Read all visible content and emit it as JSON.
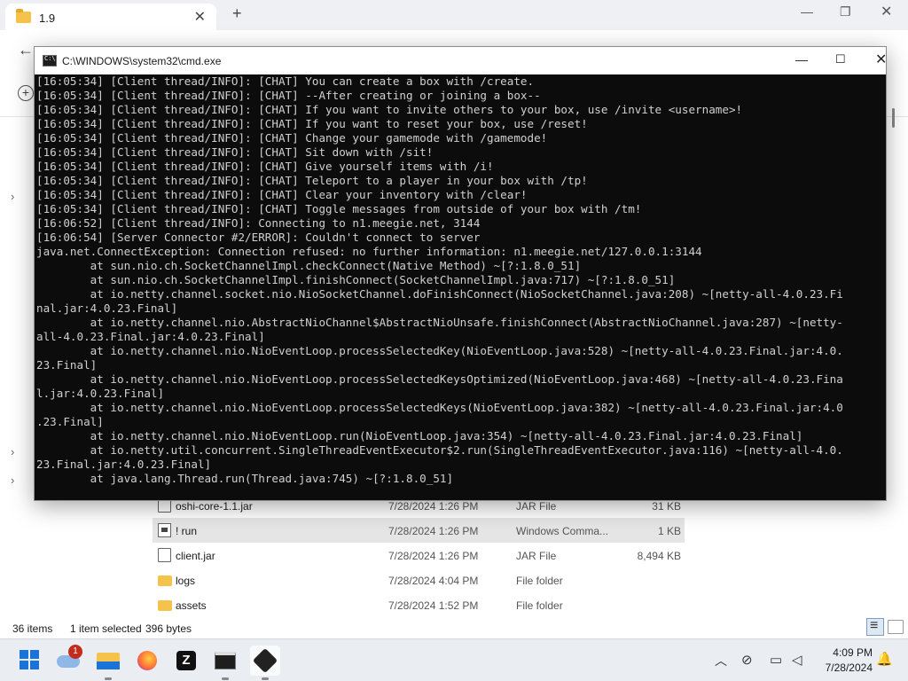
{
  "explorer": {
    "tab_title": "1.9",
    "tab_close": "✕",
    "new_tab": "+",
    "window_min": "—",
    "window_max": "❐",
    "window_close": "✕",
    "back_icon": "←",
    "new_icon": "+",
    "files": [
      {
        "name": "oshi-core-1.1.jar",
        "date": "7/28/2024 1:26 PM",
        "type": "JAR File",
        "size": "31 KB",
        "icon": "document-icon",
        "selected": false
      },
      {
        "name": "! run",
        "date": "7/28/2024 1:26 PM",
        "type": "Windows Comma...",
        "size": "1 KB",
        "icon": "batch-file-icon",
        "selected": true
      },
      {
        "name": "client.jar",
        "date": "7/28/2024 1:26 PM",
        "type": "JAR File",
        "size": "8,494 KB",
        "icon": "document-icon",
        "selected": false
      },
      {
        "name": "logs",
        "date": "7/28/2024 4:04 PM",
        "type": "File folder",
        "size": "",
        "icon": "folder-icon",
        "selected": false
      },
      {
        "name": "assets",
        "date": "7/28/2024 1:52 PM",
        "type": "File folder",
        "size": "",
        "icon": "folder-icon",
        "selected": false
      }
    ],
    "status": {
      "item_count": "36 items",
      "selection": "1 item selected",
      "selection_size": "396 bytes"
    }
  },
  "cmd": {
    "title": "C:\\WINDOWS\\system32\\cmd.exe",
    "min": "—",
    "max": "☐",
    "close": "✕",
    "lines": [
      "[16:05:34] [Client thread/INFO]: [CHAT] You can create a box with /create.",
      "[16:05:34] [Client thread/INFO]: [CHAT] --After creating or joining a box--",
      "[16:05:34] [Client thread/INFO]: [CHAT] If you want to invite others to your box, use /invite <username>!",
      "[16:05:34] [Client thread/INFO]: [CHAT] If you want to reset your box, use /reset!",
      "[16:05:34] [Client thread/INFO]: [CHAT] Change your gamemode with /gamemode!",
      "[16:05:34] [Client thread/INFO]: [CHAT] Sit down with /sit!",
      "[16:05:34] [Client thread/INFO]: [CHAT] Give yourself items with /i!",
      "[16:05:34] [Client thread/INFO]: [CHAT] Teleport to a player in your box with /tp!",
      "[16:05:34] [Client thread/INFO]: [CHAT] Clear your inventory with /clear!",
      "[16:05:34] [Client thread/INFO]: [CHAT] Toggle messages from outside of your box with /tm!",
      "[16:06:52] [Client thread/INFO]: Connecting to n1.meegie.net, 3144",
      "[16:06:54] [Server Connector #2/ERROR]: Couldn't connect to server",
      "java.net.ConnectException: Connection refused: no further information: n1.meegie.net/127.0.0.1:3144",
      "        at sun.nio.ch.SocketChannelImpl.checkConnect(Native Method) ~[?:1.8.0_51]",
      "        at sun.nio.ch.SocketChannelImpl.finishConnect(SocketChannelImpl.java:717) ~[?:1.8.0_51]",
      "        at io.netty.channel.socket.nio.NioSocketChannel.doFinishConnect(NioSocketChannel.java:208) ~[netty-all-4.0.23.Fi",
      "nal.jar:4.0.23.Final]",
      "        at io.netty.channel.nio.AbstractNioChannel$AbstractNioUnsafe.finishConnect(AbstractNioChannel.java:287) ~[netty-",
      "all-4.0.23.Final.jar:4.0.23.Final]",
      "        at io.netty.channel.nio.NioEventLoop.processSelectedKey(NioEventLoop.java:528) ~[netty-all-4.0.23.Final.jar:4.0.",
      "23.Final]",
      "        at io.netty.channel.nio.NioEventLoop.processSelectedKeysOptimized(NioEventLoop.java:468) ~[netty-all-4.0.23.Fina",
      "l.jar:4.0.23.Final]",
      "        at io.netty.channel.nio.NioEventLoop.processSelectedKeys(NioEventLoop.java:382) ~[netty-all-4.0.23.Final.jar:4.0",
      ".23.Final]",
      "        at io.netty.channel.nio.NioEventLoop.run(NioEventLoop.java:354) ~[netty-all-4.0.23.Final.jar:4.0.23.Final]",
      "        at io.netty.util.concurrent.SingleThreadEventExecutor$2.run(SingleThreadEventExecutor.java:116) ~[netty-all-4.0.",
      "23.Final.jar:4.0.23.Final]",
      "        at java.lang.Thread.run(Thread.java:745) ~[?:1.8.0_51]"
    ]
  },
  "taskbar": {
    "notification_badge": "1",
    "zed_letter": "Z",
    "tray_chevron": "︿",
    "time": "4:09 PM",
    "date": "7/28/2024"
  }
}
